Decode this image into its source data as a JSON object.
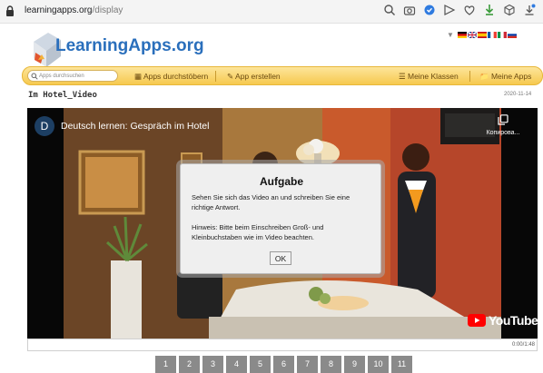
{
  "browser": {
    "url_host": "learningapps.org",
    "url_path": "/display"
  },
  "logo": {
    "text": "LearningApps.org"
  },
  "nav": {
    "search_placeholder": "Apps durchsuchen",
    "browse_label": "Apps durchstöbern",
    "create_label": "App erstellen",
    "classes_label": "Meine Klassen",
    "apps_label": "Meine Apps"
  },
  "page": {
    "title": "Im Hotel_Video",
    "date": "2020-11-14"
  },
  "video": {
    "channel_initial": "D",
    "title": "Deutsch lernen: Gespräch im Hotel",
    "copy_label": "Копирова...",
    "youtube_label": "YouTube",
    "time": "0:00/1:48"
  },
  "dialog": {
    "title": "Aufgabe",
    "text1": "Sehen Sie sich das Video an und schreiben Sie eine richtige Antwort.",
    "text2": "Hinweis: Bitte beim Einschreiben Groß- und Kleinbuchstaben wie im Video beachten.",
    "ok_label": "OK"
  },
  "pages": [
    "1",
    "2",
    "3",
    "4",
    "5",
    "6",
    "7",
    "8",
    "9",
    "10",
    "11"
  ],
  "colors": {
    "logo_blue": "#2a6fbc",
    "nav_yellow": "#f6c94f",
    "page_button": "#8a8a8a",
    "youtube_red": "#ff0000"
  }
}
